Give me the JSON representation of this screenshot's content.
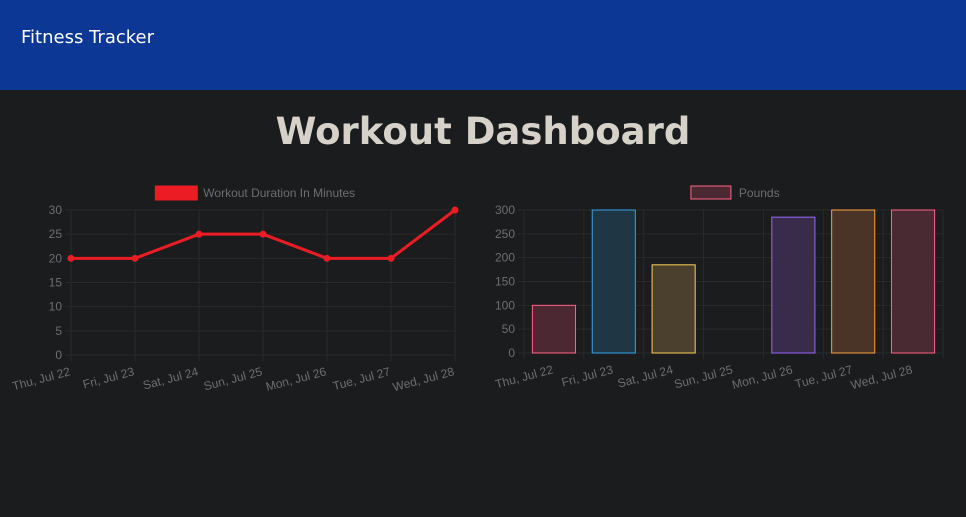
{
  "app": {
    "brand": "Fitness Tracker"
  },
  "page": {
    "title": "Workout Dashboard"
  },
  "colors": {
    "navbar": "#0c3795",
    "background": "#1b1c1d",
    "grid": "#2a2a2a",
    "text": "#6e6e6e",
    "line": "#ec1c24"
  },
  "chart_data": [
    {
      "type": "line",
      "categories": [
        "Thu, Jul 22",
        "Fri, Jul 23",
        "Sat, Jul 24",
        "Sun, Jul 25",
        "Mon, Jul 26",
        "Tue, Jul 27",
        "Wed, Jul 28"
      ],
      "series": [
        {
          "name": "Workout Duration In Minutes",
          "values": [
            20,
            20,
            25,
            25,
            20,
            20,
            30
          ],
          "color": "#ec1c24"
        }
      ],
      "yticks": [
        "30",
        "25",
        "20",
        "15",
        "10",
        "5",
        "0"
      ],
      "ylim": [
        0,
        30
      ],
      "grid": true,
      "legend": "top"
    },
    {
      "type": "bar",
      "categories": [
        "Thu, Jul 22",
        "Fri, Jul 23",
        "Sat, Jul 24",
        "Sun, Jul 25",
        "Mon, Jul 26",
        "Tue, Jul 27",
        "Wed, Jul 28"
      ],
      "series": [
        {
          "name": "Pounds",
          "values": [
            100,
            300,
            185,
            0,
            285,
            300,
            300
          ]
        }
      ],
      "bar_fills": [
        "#4b2832",
        "#1f3644",
        "#4a402d",
        "#2b2438",
        "#392b4a",
        "#4a3427",
        "#4a2a32"
      ],
      "bar_strokes": [
        "#ff6384",
        "#36a2eb",
        "#ffce56",
        "#4bc0c0",
        "#9966ff",
        "#ff9f40",
        "#ff6384"
      ],
      "yticks": [
        "300",
        "250",
        "200",
        "150",
        "100",
        "50",
        "0"
      ],
      "ylim": [
        0,
        300
      ],
      "grid": true,
      "legend": "top"
    }
  ]
}
